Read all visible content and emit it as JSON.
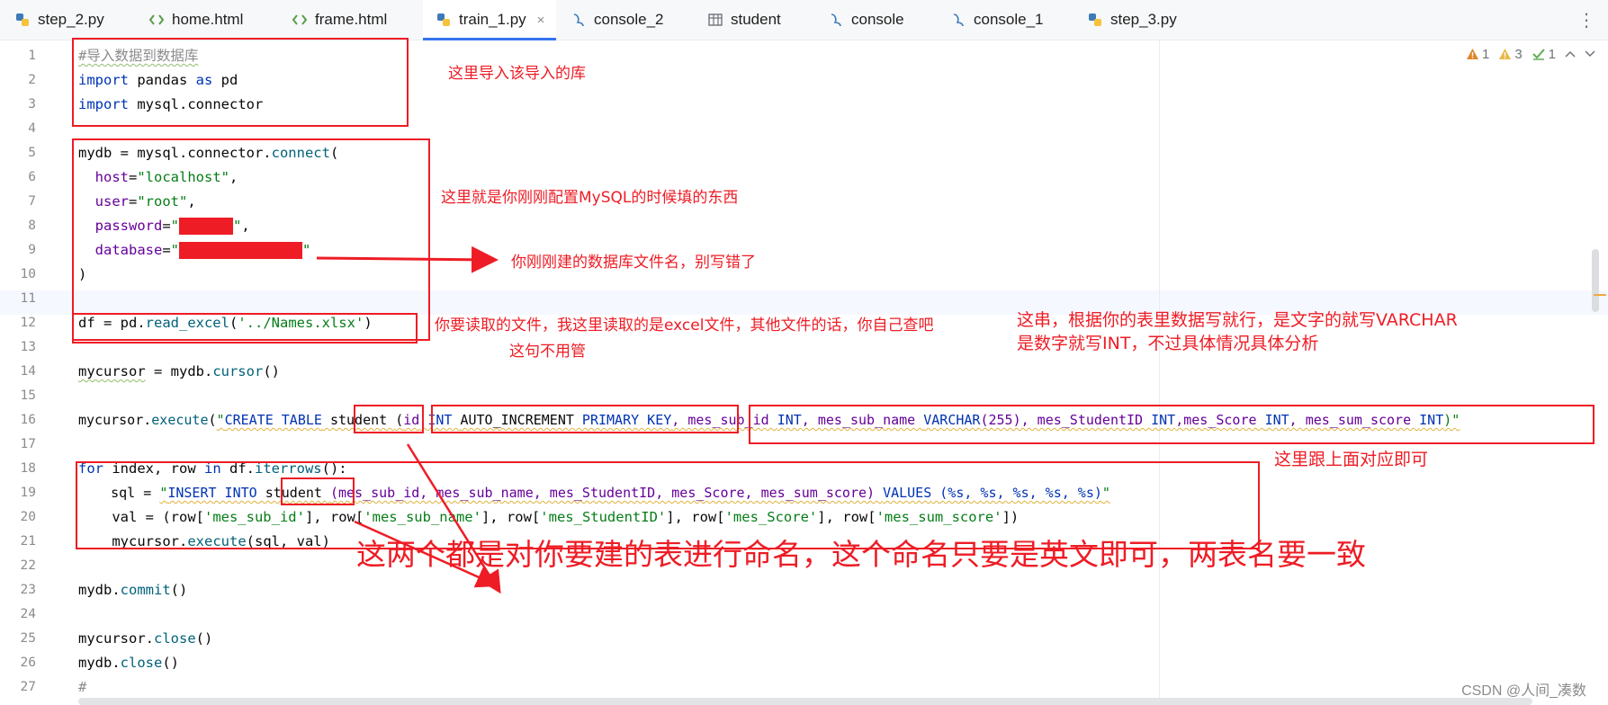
{
  "tabs": [
    {
      "label": "step_2.py",
      "icon": "python-icon"
    },
    {
      "label": "home.html",
      "icon": "html-icon"
    },
    {
      "label": "frame.html",
      "icon": "html-icon"
    },
    {
      "label": "train_1.py",
      "icon": "python-icon",
      "active": true
    },
    {
      "label": "console_2",
      "icon": "console-icon"
    },
    {
      "label": "student",
      "icon": "table-icon"
    },
    {
      "label": "console",
      "icon": "console-icon"
    },
    {
      "label": "console_1",
      "icon": "console-icon"
    },
    {
      "label": "step_3.py",
      "icon": "python-icon"
    }
  ],
  "tab_close_glyph": "×",
  "more_menu_glyph": "⋮",
  "inspections": {
    "errors": "1",
    "warnings": "3",
    "weak": "1"
  },
  "line_numbers": [
    "1",
    "2",
    "3",
    "4",
    "5",
    "6",
    "7",
    "8",
    "9",
    "10",
    "11",
    "12",
    "13",
    "14",
    "15",
    "16",
    "17",
    "18",
    "19",
    "20",
    "21",
    "22",
    "23",
    "24",
    "25",
    "26",
    "27"
  ],
  "code": {
    "l1": "#导入数据到数据库",
    "l2_import": "import",
    "l2_mod": " pandas ",
    "l2_as": "as",
    "l2_alias": " pd",
    "l3_import": "import",
    "l3_mod": " mysql.connector",
    "l5_a": "mydb = mysql.connector.",
    "l5_fn": "connect",
    "l5_b": "(",
    "l6_p": "  host",
    "l6_eq": "=",
    "l6_s": "\"localhost\"",
    "l6_c": ",",
    "l7_p": "  user",
    "l7_eq": "=",
    "l7_s": "\"root\"",
    "l7_c": ",",
    "l8_p": "  password",
    "l8_eq": "=",
    "l8_q1": "\"",
    "l8_q2": "\"",
    "l8_c": ",",
    "l9_p": "  database",
    "l9_eq": "=",
    "l9_q1": "\"",
    "l9_q2": "\"",
    "l10": ")",
    "l12_a": "df = pd.",
    "l12_fn": "read_excel",
    "l12_b": "(",
    "l12_s": "'../Names.xlsx'",
    "l12_c": ")",
    "l14_a": "mycursor",
    "l14_b": " = mydb.",
    "l14_fn": "cursor",
    "l14_c": "()",
    "l16_a": "mycursor.",
    "l16_fn": "execute",
    "l16_b": "(",
    "l16_q": "\"",
    "l16_k1": "CREATE TABLE",
    "l16_t": " student ",
    "l16_c": "(",
    "l16_id": "id",
    "l16_k2": " INT ",
    "l16_ai": "AUTO_INCREMENT",
    "l16_k3": " PRIMARY KEY",
    "l16_rest1": ", mes_sub_id ",
    "l16_k4": "INT",
    "l16_rest2": ", mes_sub_name ",
    "l16_k5": "VARCHAR",
    "l16_rest3": "(255), mes_StudentID ",
    "l16_k6": "INT",
    "l16_rest4": ",mes_Score ",
    "l16_k7": "INT",
    "l16_rest5": ", mes_sum_score ",
    "l16_k8": "INT",
    "l16_end": ")\"",
    "l18_for": "for",
    "l18_a": " index, row ",
    "l18_in": "in",
    "l18_b": " df.",
    "l18_fn": "iterrows",
    "l18_c": "():",
    "l19_a": "    sql = ",
    "l19_q": "\"",
    "l19_k1": "INSERT INTO",
    "l19_t": " student ",
    "l19_b": "(mes_sub_id, mes_sub_name, mes_StudentID, mes_Score, mes_sum_score) ",
    "l19_k2": "VALUES",
    "l19_c": " (%s, %s, %s, %s, %s)",
    "l19_q2": "\"",
    "l20_a": "    val = (row[",
    "l20_s1": "'mes_sub_id'",
    "l20_b": "], row[",
    "l20_s2": "'mes_sub_name'",
    "l20_c": "], row[",
    "l20_s3": "'mes_StudentID'",
    "l20_d": "], row[",
    "l20_s4": "'mes_Score'",
    "l20_e": "], row[",
    "l20_s5": "'mes_sum_score'",
    "l20_f": "])",
    "l21_a": "    mycursor.",
    "l21_fn": "execute",
    "l21_b": "(sql, val)",
    "l23_a": "mydb.",
    "l23_fn": "commit",
    "l23_b": "()",
    "l25_a": "mycursor.",
    "l25_fn": "close",
    "l25_b": "()",
    "l26_a": "mydb.",
    "l26_fn": "close",
    "l26_b": "()",
    "l27": "#"
  },
  "annotations": {
    "import_note": "这里导入该导入的库",
    "connect_note": "这里就是你刚刚配置MySQL的时候填的东西",
    "dbname_note": "你刚刚建的数据库文件名，别写错了",
    "excel_note": "你要读取的文件，我这里读取的是excel文件，其他文件的话，你自己查吧",
    "columns_note_1": "这串，根据你的表里数据写就行，是文字的就写VARCHAR",
    "columns_note_2": "是数字就写INT，不过具体情况具体分析",
    "ignore_note": "这句不用管",
    "match_note": "这里跟上面对应即可",
    "naming_note": "这两个都是对你要建的表进行命名，这个命名只要是英文即可，两表名要一致"
  },
  "watermark": "CSDN @人间_凑数",
  "colors": {
    "annotation_red": "#ee1c25",
    "tab_accent": "#3574f0",
    "keyword": "#0033b3",
    "string": "#067d17"
  }
}
